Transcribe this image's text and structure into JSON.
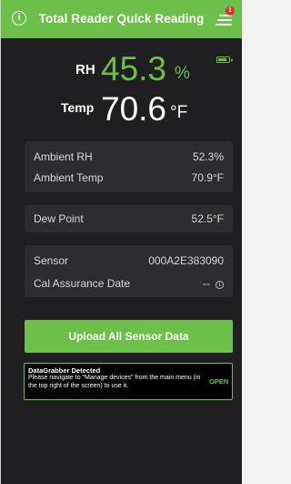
{
  "header": {
    "title": "Total Reader Quick Reading",
    "menu_badge": "1"
  },
  "readings": {
    "rh_label": "RH",
    "rh_value": "45.3",
    "rh_unit": "%",
    "temp_label": "Temp",
    "temp_value": "70.6",
    "temp_unit": "°F",
    "battery_level": 0.8
  },
  "ambient": [
    {
      "label": "Ambient RH",
      "value": "52.3%"
    },
    {
      "label": "Ambient Temp",
      "value": "70.9°F"
    }
  ],
  "dew_point": {
    "label": "Dew Point",
    "value": "52.5°F"
  },
  "sensor_info": [
    {
      "label": "Sensor",
      "value": "000A2E383090"
    },
    {
      "label": "Cal Assurance Date",
      "value": "--"
    }
  ],
  "upload_button": "Upload All Sensor Data",
  "banner": {
    "title": "DataGrabber Detected",
    "message": "Please navigate to \"Manage devices\" from the main menu (in the top right of the screen) to use it.",
    "action": "OPEN"
  },
  "colors": {
    "accent": "#6cc04a",
    "background": "#1f1f21",
    "card": "#2d2d2f",
    "badge": "#e32a2a"
  }
}
